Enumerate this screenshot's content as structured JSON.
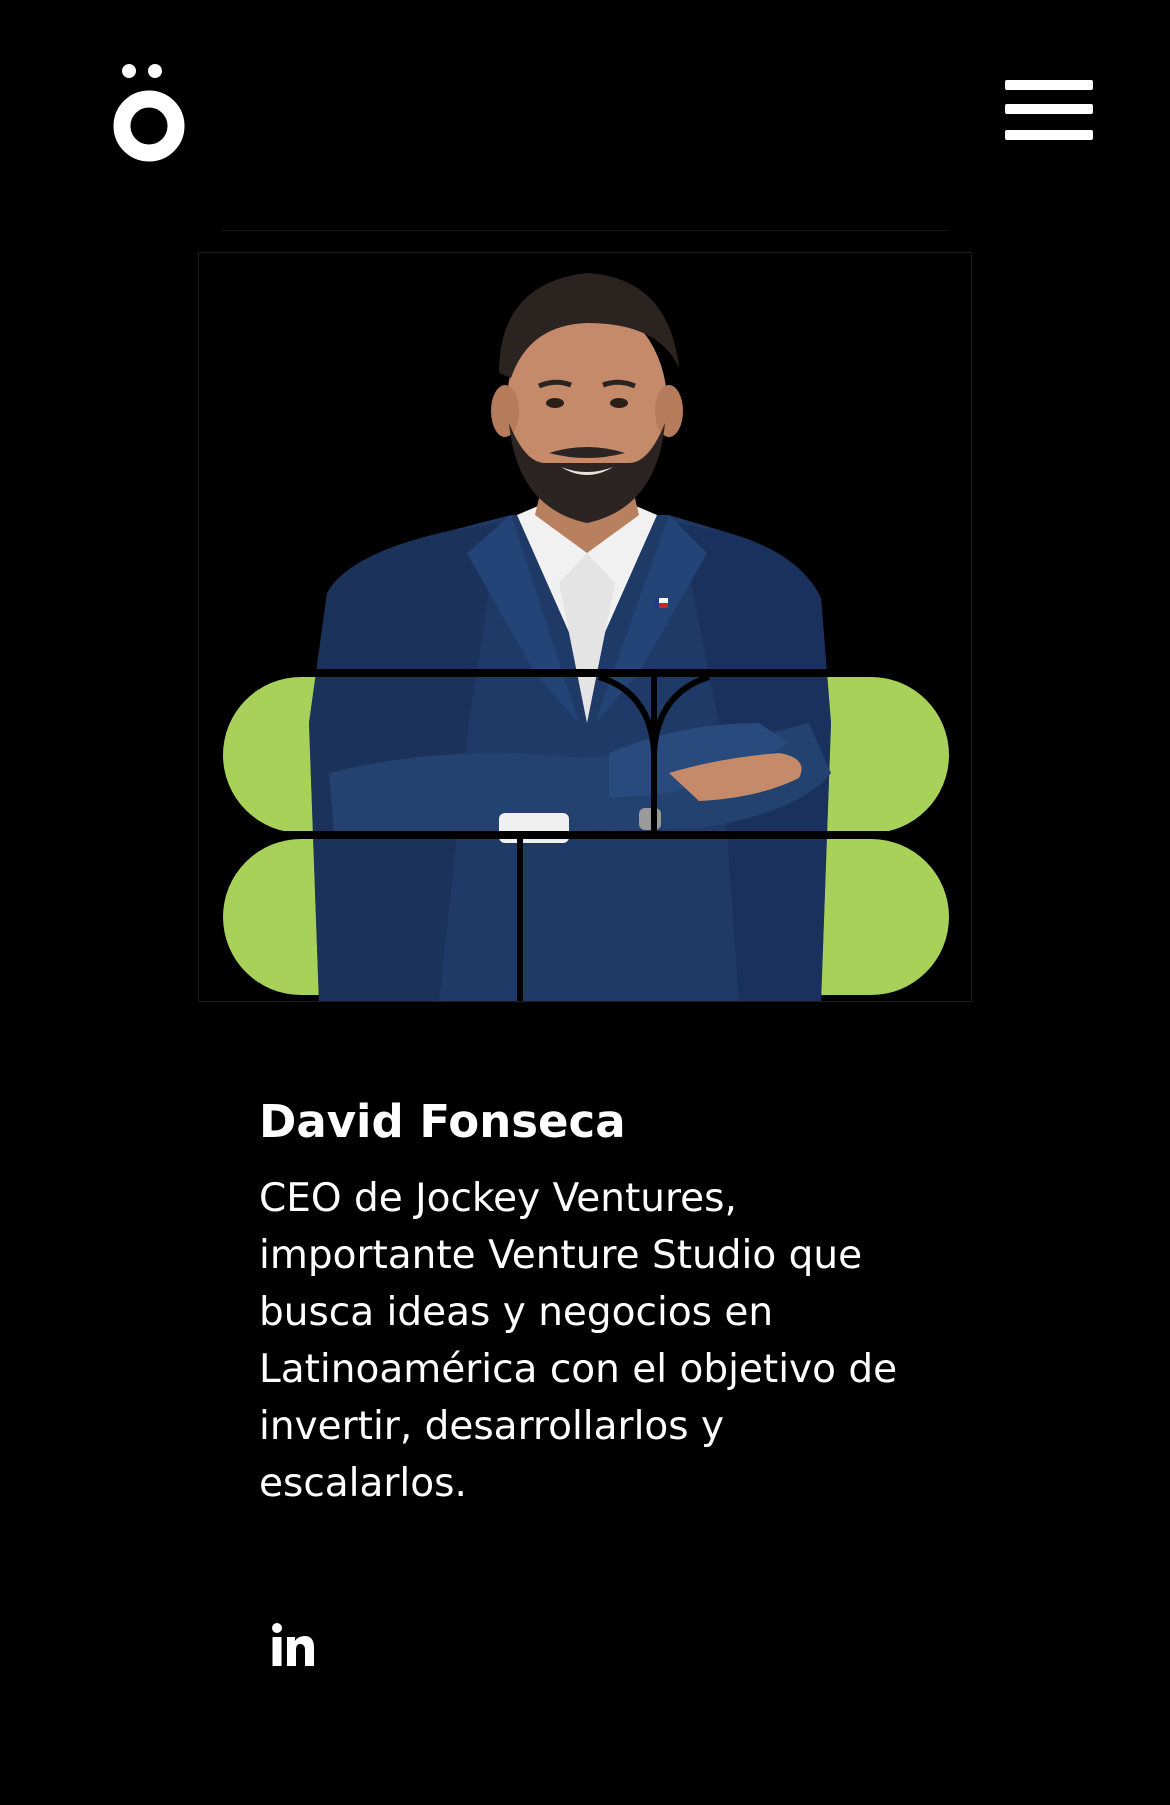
{
  "header": {
    "logo_icon": "o-umlaut-logo",
    "menu_icon": "hamburger-menu-icon"
  },
  "speaker": {
    "photo_alt": "David Fonseca",
    "name": "David Fonseca",
    "bio": "CEO de Jockey Ventures, importante Venture Studio que busca ideas y negocios en Latinoamérica con el objetivo de invertir, desarrollarlos y escalarlos.",
    "social": {
      "icon": "linkedin-icon",
      "label": "LinkedIn"
    }
  },
  "colors": {
    "background": "#000000",
    "accent": "#a8d15a",
    "text": "#ffffff",
    "jacket": "#1f3a66"
  }
}
